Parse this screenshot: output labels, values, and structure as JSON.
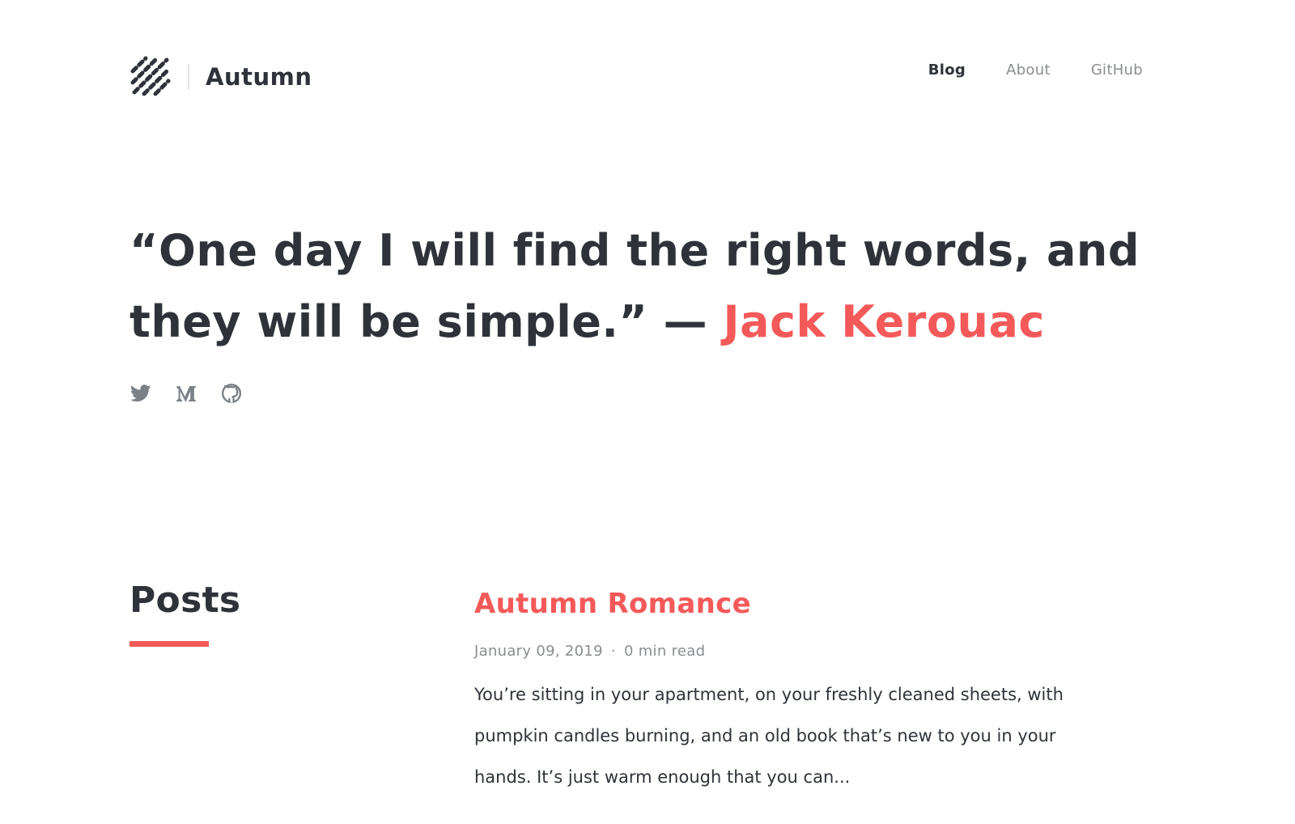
{
  "header": {
    "logo_text": "Autumn",
    "logo_icon": "diagonal-stripes-logo",
    "nav": [
      {
        "label": "Blog",
        "active": true
      },
      {
        "label": "About",
        "active": false
      },
      {
        "label": "GitHub",
        "active": false
      }
    ]
  },
  "hero": {
    "quote": "“One day I will find the right words, and they will be simple.” — ",
    "author": "Jack Kerouac"
  },
  "socials": [
    {
      "icon": "twitter-icon"
    },
    {
      "icon": "medium-icon"
    },
    {
      "icon": "github-icon"
    }
  ],
  "posts": {
    "heading": "Posts",
    "items": [
      {
        "title": "Autumn Romance",
        "date": "January 09, 2019",
        "separator": "·",
        "read_time": "0 min read",
        "excerpt": "You’re sitting in your apartment, on your freshly cleaned sheets, with pumpkin candles burning, and an old book that’s new to you in your hands. It’s just warm enough that you can..."
      }
    ]
  },
  "colors": {
    "text": "#2f3339",
    "muted": "#8a8d91",
    "accent": "#f45959",
    "icon": "#7b8087"
  }
}
